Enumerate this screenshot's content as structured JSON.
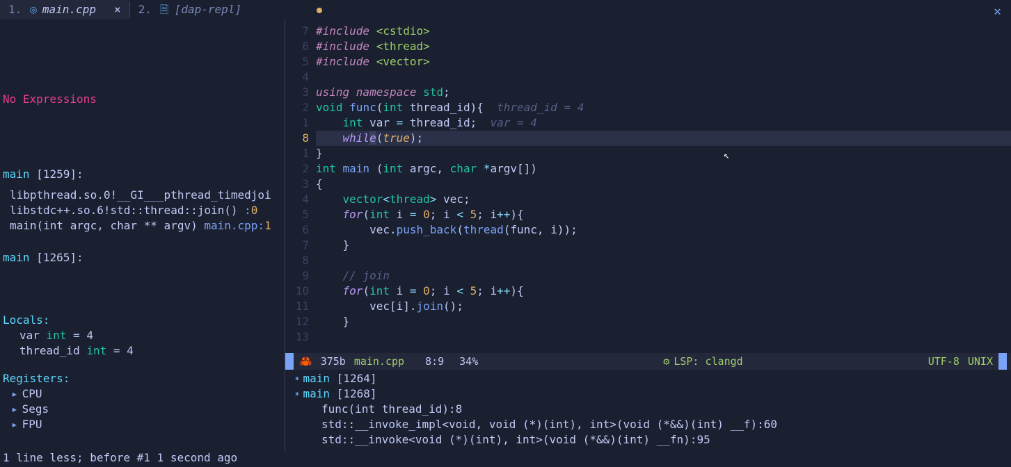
{
  "tabs": [
    {
      "num": "1.",
      "icon": "◎",
      "name": "main.cpp",
      "active": true,
      "close": "×"
    },
    {
      "num": "2.",
      "icon": "🗎",
      "name": "[dap-repl]",
      "active": false
    }
  ],
  "sidebar": {
    "no_expressions": "No Expressions",
    "threads": [
      {
        "title": "main",
        "pid": "[1259]:",
        "frames": [
          {
            "text": "libpthread.so.0!__GI___pthread_timedjoi"
          },
          {
            "text": "libstdc++.so.6!std::thread::join() ",
            "loc": ":",
            "line": "0"
          },
          {
            "text": "main(int argc, char ** argv) ",
            "loc": "main.cpp:",
            "line": "1"
          }
        ]
      },
      {
        "title": "main",
        "pid": "[1265]:",
        "frames": []
      }
    ],
    "locals_title": "Locals:",
    "locals": [
      {
        "name": "var",
        "type": "int",
        "val": "4"
      },
      {
        "name": "thread_id",
        "type": "int",
        "val": "4"
      }
    ],
    "registers_title": "Registers:",
    "registers": [
      "CPU",
      "Segs",
      "FPU"
    ]
  },
  "code": {
    "lines": [
      {
        "rel": "7",
        "tokens": [
          [
            "include",
            "#include "
          ],
          [
            "str",
            "<cstdio>"
          ]
        ]
      },
      {
        "rel": "6",
        "tokens": [
          [
            "include",
            "#include "
          ],
          [
            "str",
            "<thread>"
          ]
        ]
      },
      {
        "rel": "5",
        "tokens": [
          [
            "include",
            "#include "
          ],
          [
            "str",
            "<vector>"
          ]
        ]
      },
      {
        "rel": "4",
        "tokens": []
      },
      {
        "rel": "3",
        "tokens": [
          [
            "kw",
            "using "
          ],
          [
            "kw",
            "namespace "
          ],
          [
            "type",
            "std"
          ],
          [
            "punct",
            ";"
          ]
        ]
      },
      {
        "rel": "2",
        "tokens": [
          [
            "type",
            "void "
          ],
          [
            "fn",
            "func"
          ],
          [
            "punct",
            "("
          ],
          [
            "type",
            "int "
          ],
          [
            "id",
            "thread_id"
          ],
          [
            "punct",
            "){"
          ],
          [
            "hint",
            "  thread_id = 4"
          ]
        ]
      },
      {
        "rel": "1",
        "tokens": [
          [
            "punct",
            "    "
          ],
          [
            "type",
            "int "
          ],
          [
            "id",
            "var"
          ],
          [
            "op",
            " = "
          ],
          [
            "id",
            "thread_id"
          ],
          [
            "punct",
            ";"
          ],
          [
            "hint",
            "  var = 4"
          ]
        ]
      },
      {
        "rel": "8",
        "current": true,
        "tokens": [
          [
            "punct",
            "    "
          ],
          [
            "kw2",
            "whil"
          ],
          [
            "cursor",
            "e"
          ],
          [
            "punct",
            "("
          ],
          [
            "bool",
            "true"
          ],
          [
            "punct",
            ");"
          ]
        ]
      },
      {
        "rel": "1",
        "tokens": [
          [
            "punct",
            "}"
          ]
        ]
      },
      {
        "rel": "2",
        "tokens": [
          [
            "type",
            "int "
          ],
          [
            "fn",
            "main "
          ],
          [
            "punct",
            "("
          ],
          [
            "type",
            "int "
          ],
          [
            "id",
            "argc"
          ],
          [
            "punct",
            ", "
          ],
          [
            "type",
            "char "
          ],
          [
            "op",
            "*"
          ],
          [
            "id",
            "argv"
          ],
          [
            "punct",
            "[])"
          ]
        ]
      },
      {
        "rel": "3",
        "tokens": [
          [
            "punct",
            "{"
          ]
        ]
      },
      {
        "rel": "4",
        "tokens": [
          [
            "punct",
            "    "
          ],
          [
            "type",
            "vector"
          ],
          [
            "op",
            "<"
          ],
          [
            "type",
            "thread"
          ],
          [
            "op",
            "> "
          ],
          [
            "id",
            "vec"
          ],
          [
            "punct",
            ";"
          ]
        ]
      },
      {
        "rel": "5",
        "tokens": [
          [
            "punct",
            "    "
          ],
          [
            "kw2",
            "for"
          ],
          [
            "punct",
            "("
          ],
          [
            "type",
            "int "
          ],
          [
            "id",
            "i"
          ],
          [
            "op",
            " = "
          ],
          [
            "num",
            "0"
          ],
          [
            "punct",
            "; "
          ],
          [
            "id",
            "i"
          ],
          [
            "op",
            " < "
          ],
          [
            "num",
            "5"
          ],
          [
            "punct",
            "; "
          ],
          [
            "id",
            "i"
          ],
          [
            "op",
            "++"
          ],
          [
            "punct",
            "){"
          ]
        ]
      },
      {
        "rel": "6",
        "tokens": [
          [
            "punct",
            "        "
          ],
          [
            "id",
            "vec"
          ],
          [
            "punct",
            "."
          ],
          [
            "fn",
            "push_back"
          ],
          [
            "punct",
            "("
          ],
          [
            "fn",
            "thread"
          ],
          [
            "punct",
            "("
          ],
          [
            "id",
            "func"
          ],
          [
            "punct",
            ", "
          ],
          [
            "id",
            "i"
          ],
          [
            "punct",
            "));"
          ]
        ]
      },
      {
        "rel": "7",
        "tokens": [
          [
            "punct",
            "    }"
          ]
        ]
      },
      {
        "rel": "8",
        "tokens": []
      },
      {
        "rel": "9",
        "tokens": [
          [
            "punct",
            "    "
          ],
          [
            "cmt",
            "// join"
          ]
        ]
      },
      {
        "rel": "10",
        "tokens": [
          [
            "punct",
            "    "
          ],
          [
            "kw2",
            "for"
          ],
          [
            "punct",
            "("
          ],
          [
            "type",
            "int "
          ],
          [
            "id",
            "i"
          ],
          [
            "op",
            " = "
          ],
          [
            "num",
            "0"
          ],
          [
            "punct",
            "; "
          ],
          [
            "id",
            "i"
          ],
          [
            "op",
            " < "
          ],
          [
            "num",
            "5"
          ],
          [
            "punct",
            "; "
          ],
          [
            "id",
            "i"
          ],
          [
            "op",
            "++"
          ],
          [
            "punct",
            "){"
          ]
        ]
      },
      {
        "rel": "11",
        "tokens": [
          [
            "punct",
            "        "
          ],
          [
            "id",
            "vec"
          ],
          [
            "punct",
            "["
          ],
          [
            "id",
            "i"
          ],
          [
            "punct",
            "]."
          ],
          [
            "fn",
            "join"
          ],
          [
            "punct",
            "();"
          ]
        ]
      },
      {
        "rel": "12",
        "tokens": [
          [
            "punct",
            "    }"
          ]
        ]
      },
      {
        "rel": "13",
        "tokens": []
      }
    ]
  },
  "statusline": {
    "crab": "🦀",
    "size": "375b",
    "fname": "main.cpp",
    "pos": "8:9",
    "pct": "34%",
    "lsp_icon": "⚙",
    "lsp": "LSP: clangd",
    "enc": "UTF-8",
    "ff": "UNIX"
  },
  "threads_pane": [
    {
      "type": "thread",
      "name": "main",
      "pid": "[1264]"
    },
    {
      "type": "thread",
      "name": "main",
      "pid": "[1268]"
    },
    {
      "type": "stack",
      "text": "func(int thread_id):8"
    },
    {
      "type": "stack",
      "text": "std::__invoke_impl<void, void (*)(int), int>(void (*&&)(int) __f):60"
    },
    {
      "type": "stack",
      "text": "std::__invoke<void (*)(int), int>(void (*&&)(int) __fn):95"
    }
  ],
  "cmdline": "1 line less; before #1  1 second ago"
}
